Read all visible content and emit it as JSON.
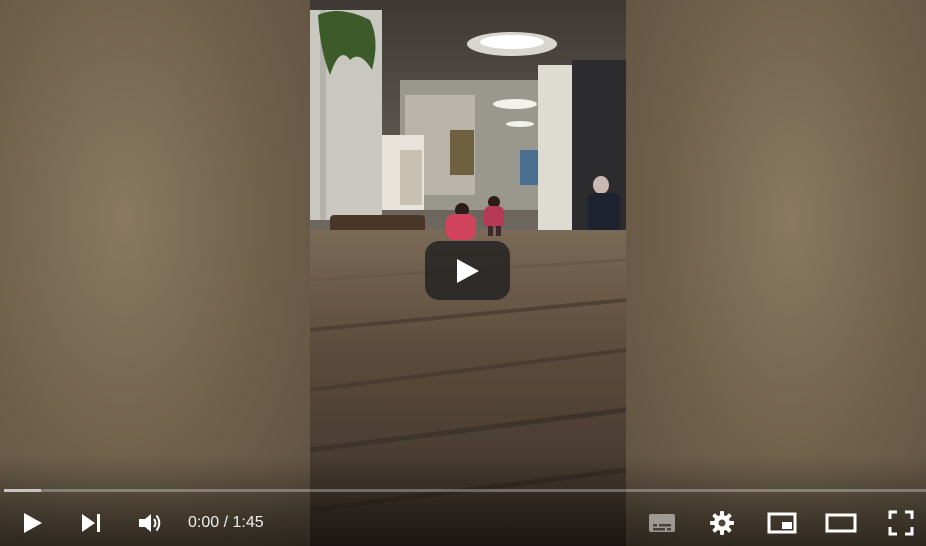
{
  "player": {
    "time_current": "0:00",
    "time_separator": " / ",
    "time_duration": "1:45",
    "progress_loaded": 0.04
  },
  "controls": {
    "play_icon": "play-icon",
    "next_icon": "skip-next-icon",
    "volume_icon": "volume-icon",
    "subtitles_icon": "subtitles-icon",
    "settings_icon": "gear-icon",
    "miniplayer_icon": "miniplayer-icon",
    "theater_icon": "theater-mode-icon",
    "fullscreen_icon": "fullscreen-icon"
  },
  "colors": {
    "control_fg": "#ffffff",
    "big_play_bg": "#212121",
    "progress_track": "#7f7f7f"
  }
}
